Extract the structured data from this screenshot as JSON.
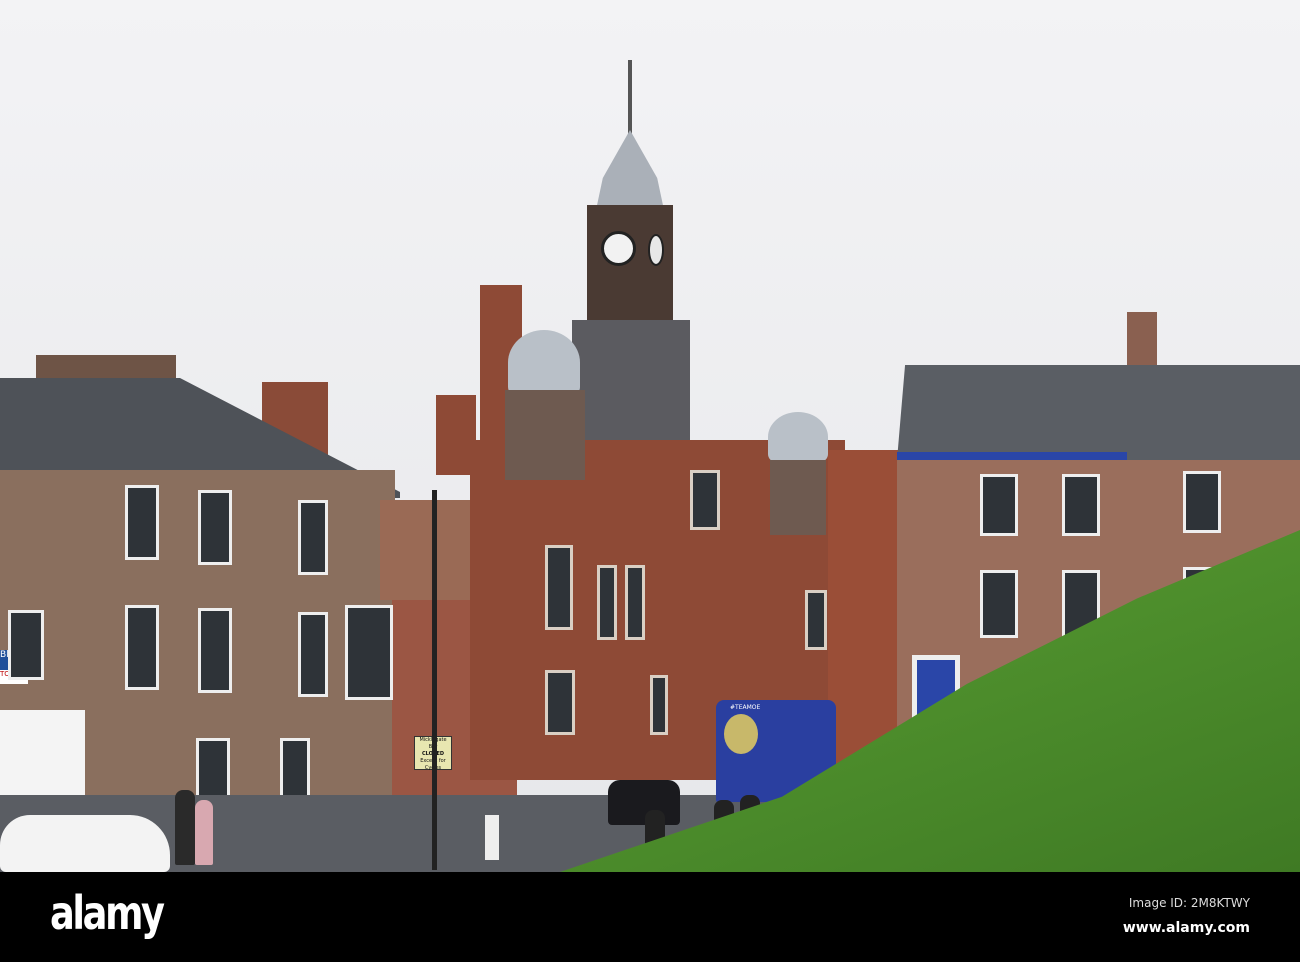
{
  "photo": {
    "street_sign": {
      "line1": "Micklegate Bar",
      "line2": "CLOSED",
      "line3": "Except for",
      "line4": "Cycles"
    },
    "bus_text": "#TEAMOE",
    "estate_sign": "TO LET",
    "shop_sign": "Blacks"
  },
  "watermark": {
    "logo": "alamy",
    "image_id": "Image ID: 2M8KTWY",
    "url": "www.alamy.com"
  },
  "colors": {
    "sky": "#eeeff1",
    "brick": "#8a6f5e",
    "red_brick": "#8e4a36",
    "grass": "#4f8f2c",
    "bus": "#2a3fa0"
  }
}
